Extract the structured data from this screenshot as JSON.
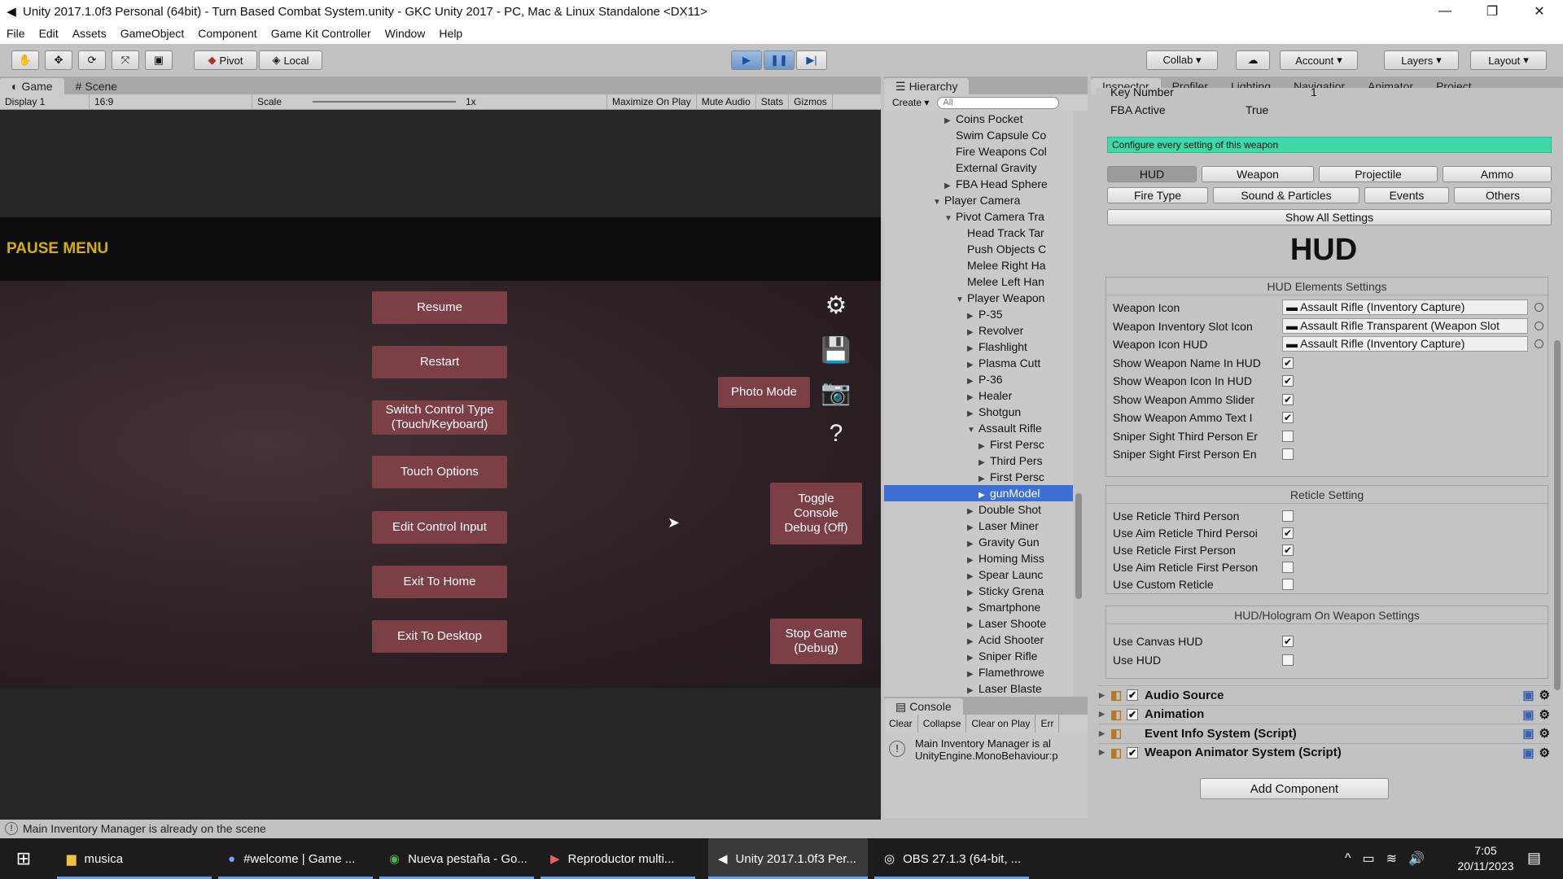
{
  "window": {
    "title": "Unity 2017.1.0f3 Personal (64bit) - Turn Based Combat System.unity - GKC Unity 2017 - PC, Mac & Linux Standalone <DX11>",
    "minimize": "—",
    "maximize": "❐",
    "close": "✕"
  },
  "menu": [
    "File",
    "Edit",
    "Assets",
    "GameObject",
    "Component",
    "Game Kit Controller",
    "Window",
    "Help"
  ],
  "toolbar": {
    "pivot": "Pivot",
    "local": "Local",
    "collab": "Collab ▾",
    "account": "Account",
    "layers": "Layers",
    "layout": "Layout"
  },
  "game": {
    "tabs": {
      "game": "Game",
      "scene": "Scene"
    },
    "display": "Display 1",
    "aspect": "16:9",
    "scale_label": "Scale",
    "scale_value": "1x",
    "maximize_on_play": "Maximize On Play",
    "mute_audio": "Mute Audio",
    "stats": "Stats",
    "gizmos": "Gizmos",
    "pause_title": "PAUSE MENU",
    "buttons": {
      "resume": "Resume",
      "restart": "Restart",
      "switch_control_1": "Switch Control Type",
      "switch_control_2": "(Touch/Keyboard)",
      "touch_options": "Touch Options",
      "edit_control_input": "Edit Control Input",
      "exit_home": "Exit To Home",
      "exit_desktop": "Exit To Desktop",
      "photo_mode": "Photo Mode",
      "toggle_console_1": "Toggle",
      "toggle_console_2": "Console",
      "toggle_console_3": "Debug (Off)",
      "stop_game_1": "Stop Game",
      "stop_game_2": "(Debug)"
    }
  },
  "hierarchy": {
    "tab": "Hierarchy",
    "create": "Create ▾",
    "search_placeholder": "All",
    "rows": [
      {
        "label": "Coins Pocket",
        "arrow": "▶",
        "depth": 5
      },
      {
        "label": "Swim Capsule Co",
        "arrow": "",
        "depth": 5
      },
      {
        "label": "Fire Weapons Col",
        "arrow": "",
        "depth": 5
      },
      {
        "label": "External Gravity",
        "arrow": "",
        "depth": 5
      },
      {
        "label": "FBA Head Sphere",
        "arrow": "▶",
        "depth": 5
      },
      {
        "label": "Player Camera",
        "arrow": "▼",
        "depth": 4
      },
      {
        "label": "Pivot Camera Tra",
        "arrow": "▼",
        "depth": 5
      },
      {
        "label": "Head Track Tar",
        "arrow": "",
        "depth": 6
      },
      {
        "label": "Push Objects C",
        "arrow": "",
        "depth": 6
      },
      {
        "label": "Melee Right Ha",
        "arrow": "",
        "depth": 6
      },
      {
        "label": "Melee Left Han",
        "arrow": "",
        "depth": 6
      },
      {
        "label": "Player Weapon",
        "arrow": "▼",
        "depth": 6
      },
      {
        "label": "P-35",
        "arrow": "▶",
        "depth": 7
      },
      {
        "label": "Revolver",
        "arrow": "▶",
        "depth": 7
      },
      {
        "label": "Flashlight",
        "arrow": "▶",
        "depth": 7
      },
      {
        "label": "Plasma Cutt",
        "arrow": "▶",
        "depth": 7
      },
      {
        "label": "P-36",
        "arrow": "▶",
        "depth": 7
      },
      {
        "label": "Healer",
        "arrow": "▶",
        "depth": 7
      },
      {
        "label": "Shotgun",
        "arrow": "▶",
        "depth": 7
      },
      {
        "label": "Assault Rifle",
        "arrow": "▼",
        "depth": 7
      },
      {
        "label": "First Persc",
        "arrow": "▶",
        "depth": 8
      },
      {
        "label": "Third Pers",
        "arrow": "▶",
        "depth": 8
      },
      {
        "label": "First Persc",
        "arrow": "▶",
        "depth": 8
      },
      {
        "label": "gunModel",
        "arrow": "▶",
        "depth": 8,
        "selected": true
      },
      {
        "label": "Double Shot",
        "arrow": "▶",
        "depth": 7
      },
      {
        "label": "Laser Miner",
        "arrow": "▶",
        "depth": 7
      },
      {
        "label": "Gravity Gun",
        "arrow": "▶",
        "depth": 7
      },
      {
        "label": "Homing Miss",
        "arrow": "▶",
        "depth": 7
      },
      {
        "label": "Spear Launc",
        "arrow": "▶",
        "depth": 7
      },
      {
        "label": "Sticky Grena",
        "arrow": "▶",
        "depth": 7
      },
      {
        "label": "Smartphone",
        "arrow": "▶",
        "depth": 7
      },
      {
        "label": "Laser Shoote",
        "arrow": "▶",
        "depth": 7
      },
      {
        "label": "Acid Shooter",
        "arrow": "▶",
        "depth": 7
      },
      {
        "label": "Sniper Rifle",
        "arrow": "▶",
        "depth": 7
      },
      {
        "label": "Flamethrowe",
        "arrow": "▶",
        "depth": 7
      },
      {
        "label": "Laser Blaste",
        "arrow": "▶",
        "depth": 7
      }
    ]
  },
  "console": {
    "tab": "Console",
    "clear": "Clear",
    "collapse": "Collapse",
    "clear_on_play": "Clear on Play",
    "error_pause": "Err",
    "line1": "Main Inventory Manager is al",
    "line2": "UnityEngine.MonoBehaviour:p"
  },
  "inspector": {
    "tabs": [
      "Inspector",
      "Profiler",
      "Lighting",
      "Navigatior",
      "Animator",
      "Project"
    ],
    "key_number_label": "Key Number",
    "key_number_value": "1",
    "fba_active_label": "FBA Active",
    "fba_active_value": "True",
    "configure_banner": "Configure every setting of this weapon",
    "row1": [
      "HUD",
      "Weapon",
      "Projectile",
      "Ammo"
    ],
    "row2": [
      "Fire Type",
      "Sound & Particles",
      "Events",
      "Others"
    ],
    "show_all": "Show All Settings",
    "hud_heading": "HUD",
    "hud_elements_title": "HUD Elements Settings",
    "hud_elements": [
      {
        "label": "Weapon Icon",
        "type": "object",
        "value": "Assault Rifle (Inventory Capture)"
      },
      {
        "label": "Weapon Inventory Slot Icon",
        "type": "object",
        "value": "Assault Rifle Transparent (Weapon Slot"
      },
      {
        "label": "Weapon Icon HUD",
        "type": "object",
        "value": "Assault Rifle (Inventory Capture)"
      },
      {
        "label": "Show Weapon Name In HUD",
        "type": "check",
        "checked": true
      },
      {
        "label": "Show Weapon Icon In HUD",
        "type": "check",
        "checked": true
      },
      {
        "label": "Show Weapon Ammo Slider",
        "type": "check",
        "checked": true
      },
      {
        "label": "Show Weapon Ammo Text I",
        "type": "check",
        "checked": true
      },
      {
        "label": "Sniper Sight Third Person Er",
        "type": "check",
        "checked": false
      },
      {
        "label": "Sniper Sight First Person En",
        "type": "check",
        "checked": false
      }
    ],
    "reticle_title": "Reticle Setting",
    "reticle": [
      {
        "label": "Use Reticle Third Person",
        "checked": false
      },
      {
        "label": "Use Aim Reticle Third Persoi",
        "checked": true
      },
      {
        "label": "Use Reticle First Person",
        "checked": true
      },
      {
        "label": "Use Aim Reticle First Person",
        "checked": false
      },
      {
        "label": "Use Custom Reticle",
        "checked": false
      }
    ],
    "hologram_title": "HUD/Hologram On Weapon Settings",
    "hologram": [
      {
        "label": "Use Canvas HUD",
        "checked": true
      },
      {
        "label": "Use HUD",
        "checked": false
      }
    ],
    "components": [
      {
        "name": "Audio Source",
        "enabled": true
      },
      {
        "name": "Animation",
        "enabled": true
      },
      {
        "name": "Event Info System (Script)",
        "enabled": null
      },
      {
        "name": "Weapon Animator System (Script)",
        "enabled": true
      }
    ],
    "add_component": "Add Component"
  },
  "status": {
    "message": "Main Inventory Manager is already on the scene"
  },
  "taskbar": {
    "items": [
      "musica",
      "#welcome | Game ...",
      "Nueva pestaña - Go...",
      "Reproductor multi...",
      "Unity 2017.1.0f3 Per...",
      "OBS 27.1.3 (64-bit, ..."
    ],
    "time": "7:05",
    "date": "20/11/2023"
  },
  "colors": {
    "pause_title": "#d6b000",
    "game_button": "#7d3f46",
    "banner": "#3fd8a8",
    "selection": "#3d6fd4"
  }
}
